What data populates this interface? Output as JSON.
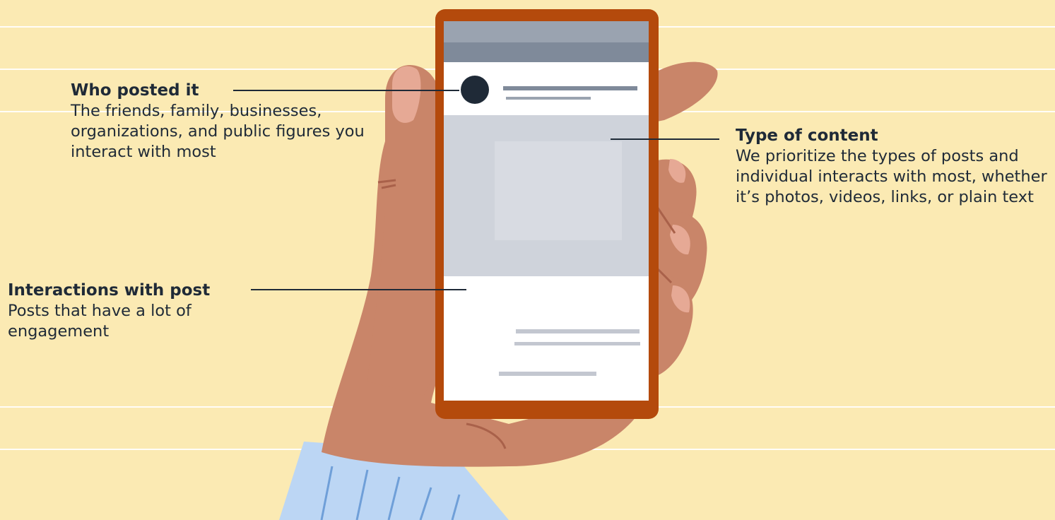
{
  "callouts": {
    "who_posted": {
      "title": "Who posted it",
      "body": "The friends, family, businesses, organizations, and public figures you interact with most"
    },
    "type_of_content": {
      "title": "Type of content",
      "body": "We prioritize the types of posts and individual interacts with most, whether it’s photos, videos, links, or plain text"
    },
    "interactions": {
      "title": "Interactions with post",
      "body": "Posts that have a lot of engagement"
    }
  },
  "colors": {
    "background": "#fbeab3",
    "phone_frame": "#b44a0c",
    "skin": "#c98569",
    "sleeve": "#bcd6f4",
    "leader_line": "#1f2a37"
  }
}
